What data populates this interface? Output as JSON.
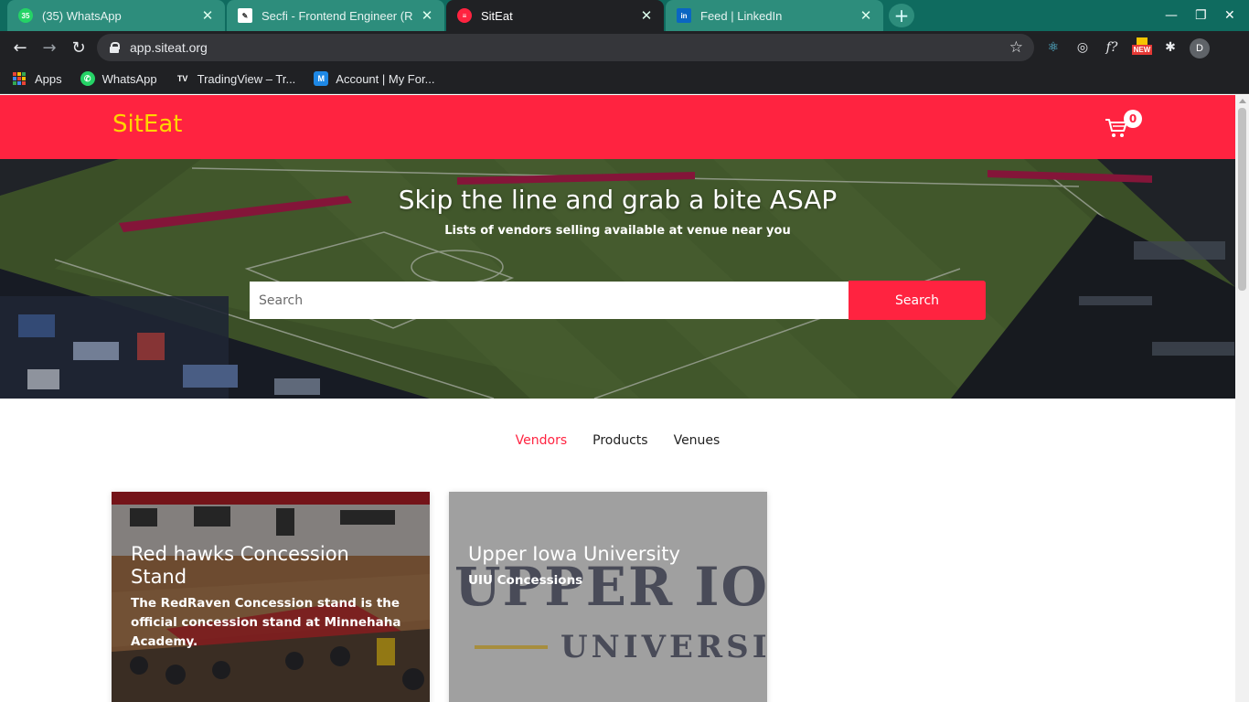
{
  "browser": {
    "tabs": [
      {
        "title": "(35) WhatsApp",
        "favicon": "whatsapp-icon",
        "badge": "35"
      },
      {
        "title": "Secfi - Frontend Engineer (Re",
        "favicon": "secfi-icon"
      },
      {
        "title": "SitEat",
        "favicon": "siteat-icon"
      },
      {
        "title": "Feed | LinkedIn",
        "favicon": "linkedin-icon",
        "badge": "in"
      }
    ],
    "active_tab": 2,
    "url": "app.siteat.org",
    "extension_new_badge": "NEW",
    "profile_initial": "D",
    "bookmarks": [
      {
        "label": "Apps",
        "icon": "apps-grid-icon"
      },
      {
        "label": "WhatsApp",
        "icon": "whatsapp-icon"
      },
      {
        "label": "TradingView – Tr...",
        "icon": "tradingview-icon"
      },
      {
        "label": "Account | My For...",
        "icon": "account-icon"
      }
    ]
  },
  "site": {
    "brand": "SitEat",
    "cart_count": "0",
    "colors": {
      "primary": "#ff2340",
      "brand_text": "#ffd500"
    }
  },
  "hero": {
    "title": "Skip the line and grab a bite ASAP",
    "subtitle": "Lists of vendors selling available at venue near you",
    "search_placeholder": "Search",
    "search_button": "Search"
  },
  "tabs": [
    {
      "label": "Vendors",
      "active": true
    },
    {
      "label": "Products",
      "active": false
    },
    {
      "label": "Venues",
      "active": false
    }
  ],
  "cards": [
    {
      "title": "Red hawks Concession Stand",
      "description": "The RedRaven Concession stand is the official concession stand at Minnehaha Academy."
    },
    {
      "title": "Upper Iowa University",
      "description": "UIU Concessions",
      "image_text_line1": "UPPER IO",
      "image_text_line2": "UNIVERSIT"
    }
  ]
}
